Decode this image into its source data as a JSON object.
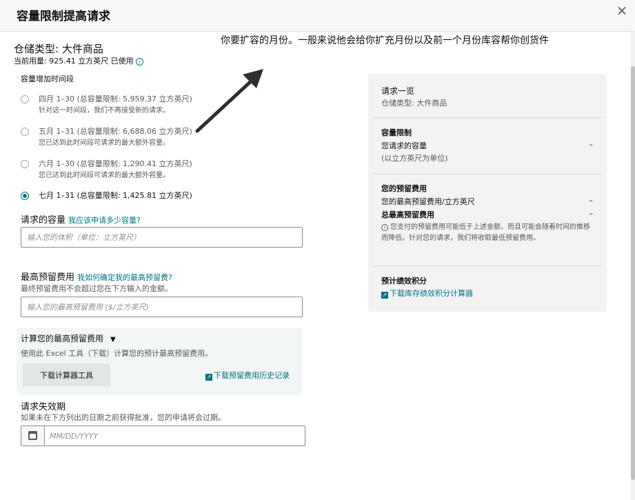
{
  "header": {
    "title": "容量限制提高请求",
    "close_label": "×"
  },
  "annotation": "你要扩容的月份。一般来说他会给你扩充月份以及前一个月份库容帮你创货件",
  "storage_type": "仓储类型: 大件商品",
  "usage": "当前用量: 925.41 立方英尺 已使用",
  "usage_info_icon": "info-icon",
  "period_label": "容量增加时间段",
  "periods": [
    {
      "title": "四月 1–30 (总容量限制: 5,959.37 立方英尺)",
      "sub": "针对这一时间段，我们不再接受新的请求。",
      "selected": false
    },
    {
      "title": "五月 1–31 (总容量限制: 6,688.06 立方英尺)",
      "sub": "您已达到此时间段可请求的最大额外容量。",
      "selected": false
    },
    {
      "title": "六月 1–30 (总容量限制: 1,290.41 立方英尺)",
      "sub": "您已达到此时间段可请求的最大额外容量。",
      "selected": false
    },
    {
      "title": "七月 1–31 (总容量限制: 1,425.81 立方英尺)",
      "sub": "",
      "selected": true
    }
  ],
  "requested_capacity": {
    "label": "请求的容量",
    "link": "我应该申请多少容量?",
    "placeholder": "输入您的体积（单位：立方英尺）"
  },
  "max_fee": {
    "label": "最高预留费用",
    "link": "我如何确定我的最高预留费?",
    "hint": "最终预留费用不会超过您在下方输入的金额。",
    "placeholder": "输入您的最高预留费用 ($/立方英尺)"
  },
  "calculator": {
    "title": "计算您的最高预留费用",
    "caret": "▼",
    "desc": "使用此 Excel 工具（下载）计算您的预计最高预留费用。",
    "button": "下载计算器工具",
    "link": "下载预留费用历史记录"
  },
  "expiry": {
    "label": "请求失效期",
    "hint": "如果未在下方列出的日期之前获得批准，您的申请将会过期。",
    "placeholder": "MM/DD/YYYY"
  },
  "summary": {
    "title": "请求一览",
    "storage_type": "仓储类型: 大件商品",
    "capacity_title": "容量限制",
    "capacity_requested": "您请求的容量",
    "capacity_unit": "(以立方英尺为单位)",
    "capacity_value": "–",
    "fee_title": "您的预留费用",
    "fee_max_per": "您的最高预留费用/立方英尺",
    "fee_max_per_value": "–",
    "fee_total": "总最高预留费用",
    "fee_total_value": "–",
    "fee_note": "您支付的预留费用可能低于上述金额，而且可能会随着时间的推移而降低。针对您的请求，我们将收取最低预留费用。",
    "perf_title": "预计绩效积分",
    "perf_link": "下载库存绩效积分计算器"
  },
  "colors": {
    "accent": "#007185",
    "panel": "#f3f3f3",
    "header": "#f7f8f8",
    "arrow": "#2b2f33"
  }
}
